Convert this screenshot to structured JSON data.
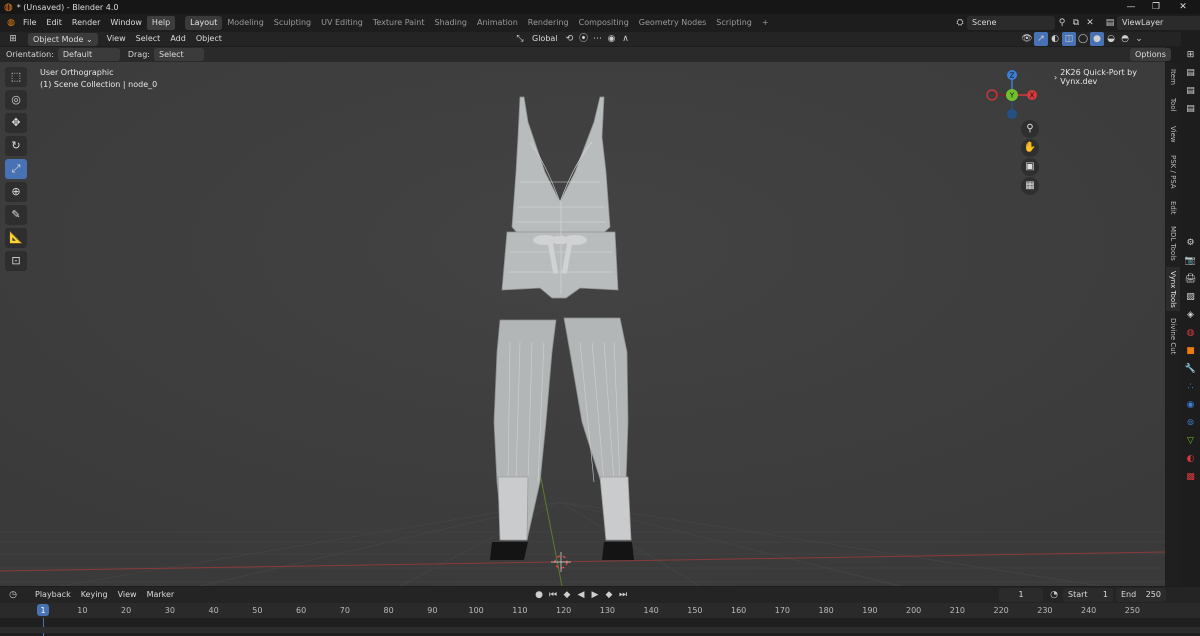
{
  "window": {
    "title": "* (Unsaved) - Blender 4.0",
    "controls": [
      "—",
      "❐",
      "✕"
    ]
  },
  "topbar": {
    "menus": [
      "File",
      "Edit",
      "Render",
      "Window",
      "Help"
    ],
    "workspaces": [
      "Layout",
      "Modeling",
      "Sculpting",
      "UV Editing",
      "Texture Paint",
      "Shading",
      "Animation",
      "Rendering",
      "Compositing",
      "Geometry Nodes",
      "Scripting"
    ],
    "active_workspace": "Layout",
    "add_tab": "+",
    "scene": "Scene",
    "view_layer": "ViewLayer"
  },
  "header": {
    "mode": "Object Mode",
    "menus": [
      "View",
      "Select",
      "Add",
      "Object"
    ],
    "transform_orientation": "Global",
    "orientation_label": "Orientation:",
    "orientation_value": "Default",
    "drag_label": "Drag:",
    "drag_value": "Select Box",
    "options": "Options"
  },
  "viewport": {
    "view_name": "User Orthographic",
    "collection": "(1) Scene Collection | node_0",
    "addon_panel": "2K26 Quick-Port by Vynx.dev",
    "gizmo": {
      "z": "Z",
      "x": "X",
      "y": "Y"
    }
  },
  "sidebar_tabs": [
    "Item",
    "Tool",
    "View",
    "PSK / PSA",
    "Edit",
    "MDL Tools",
    "Vynx Tools",
    "Divine Cut"
  ],
  "timeline": {
    "menus": [
      "Playback",
      "Keying",
      "View",
      "Marker"
    ],
    "current_frame": "1",
    "start_label": "Start",
    "start": "1",
    "end_label": "End",
    "end": "250",
    "ticks": [
      "1",
      "10",
      "20",
      "30",
      "40",
      "50",
      "60",
      "70",
      "80",
      "90",
      "100",
      "110",
      "120",
      "130",
      "140",
      "150",
      "160",
      "170",
      "180",
      "190",
      "200",
      "210",
      "220",
      "230",
      "240",
      "250"
    ]
  },
  "colors": {
    "accent": "#4772b3",
    "x_axis": "#d9383b",
    "y_axis": "#6fbf2e",
    "z_axis": "#3b7fd6",
    "grid_red": "#8a3a3a"
  }
}
